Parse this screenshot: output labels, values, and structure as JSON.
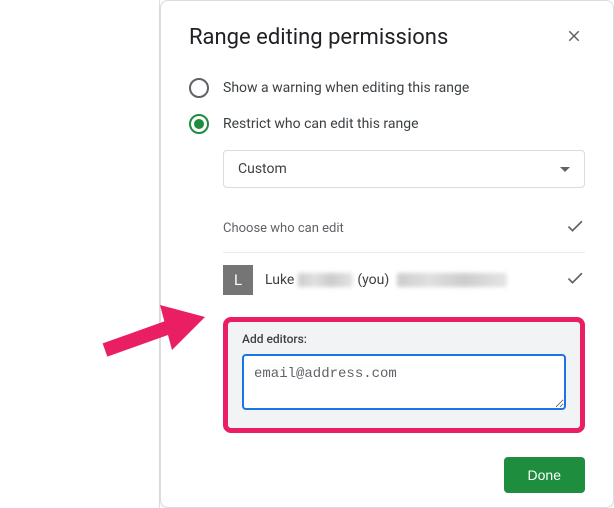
{
  "dialog": {
    "title": "Range editing permissions",
    "radio_warning": "Show a warning when editing this range",
    "radio_restrict": "Restrict who can edit this range",
    "select_value": "Custom",
    "choose_label": "Choose who can edit",
    "user": {
      "initial": "L",
      "name_first": "Luke",
      "you": "(you)"
    },
    "add_editors_label": "Add editors:",
    "editor_input_value": "email@address.com",
    "done_button": "Done"
  },
  "annotation": {
    "arrow_color": "#e91e63"
  }
}
